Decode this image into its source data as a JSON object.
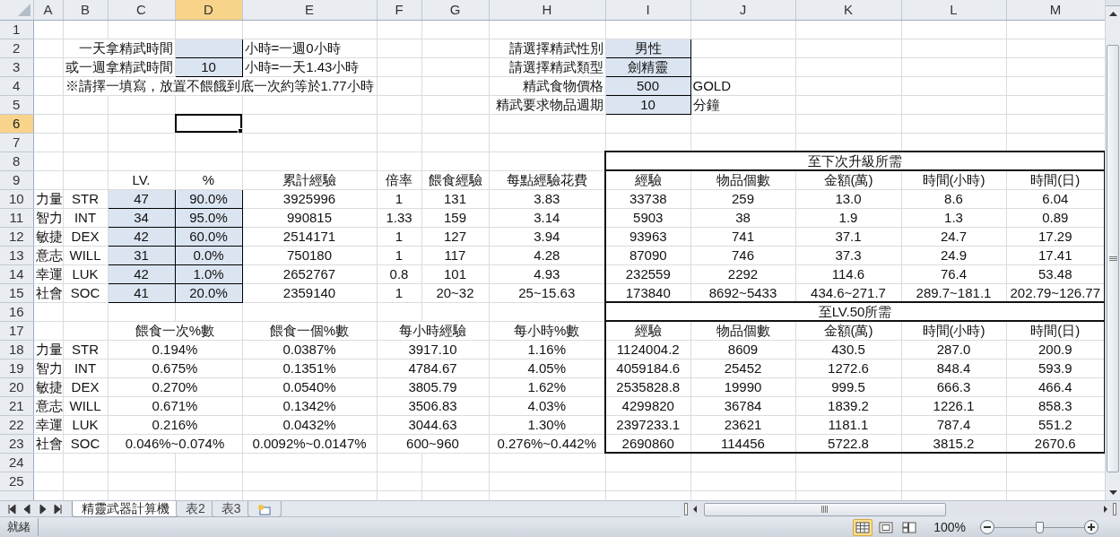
{
  "sheet": {
    "columns": [
      {
        "label": "A",
        "selected": false
      },
      {
        "label": "B",
        "selected": false
      },
      {
        "label": "C",
        "selected": false
      },
      {
        "label": "D",
        "selected": true
      },
      {
        "label": "E",
        "selected": false
      },
      {
        "label": "F",
        "selected": false
      },
      {
        "label": "G",
        "selected": false
      },
      {
        "label": "H",
        "selected": false
      },
      {
        "label": "I",
        "selected": false
      },
      {
        "label": "J",
        "selected": false
      },
      {
        "label": "K",
        "selected": false
      },
      {
        "label": "L",
        "selected": false
      },
      {
        "label": "M",
        "selected": false
      }
    ],
    "rows": [
      {
        "number": "1",
        "selected": false
      },
      {
        "number": "2",
        "selected": false,
        "cells": [
          null,
          null,
          {
            "text": "一天拿精武時間",
            "kind": "label"
          },
          {
            "kind": "input"
          },
          {
            "text": "小時=一週0小時",
            "kind": "note"
          },
          null,
          null,
          {
            "text": "請選擇精武性別",
            "kind": "label"
          },
          {
            "text": "男性",
            "kind": "input"
          }
        ]
      },
      {
        "number": "3",
        "selected": false,
        "cells": [
          null,
          null,
          {
            "text": "或一週拿精武時間",
            "kind": "label"
          },
          {
            "text": "10",
            "kind": "input"
          },
          {
            "text": "小時=一天1.43小時",
            "kind": "note"
          },
          null,
          null,
          {
            "text": "請選擇精武類型",
            "kind": "label"
          },
          {
            "text": "劍精靈",
            "kind": "input"
          }
        ]
      },
      {
        "number": "4",
        "selected": false,
        "cells": [
          null,
          {
            "text": "※請擇一填寫，放置不餵餓到底一次約等於1.77小時",
            "kind": "note"
          },
          null,
          null,
          null,
          null,
          null,
          {
            "text": "精武食物價格",
            "kind": "label"
          },
          {
            "text": "500",
            "kind": "input"
          },
          {
            "text": "GOLD",
            "kind": "note"
          }
        ]
      },
      {
        "number": "5",
        "selected": false,
        "cells": [
          null,
          null,
          null,
          null,
          null,
          null,
          null,
          {
            "text": "精武要求物品週期",
            "kind": "label"
          },
          {
            "text": "10",
            "kind": "input"
          },
          {
            "text": "分鐘",
            "kind": "note"
          }
        ]
      },
      {
        "number": "6",
        "selected": true
      },
      {
        "number": "7",
        "selected": false
      },
      {
        "number": "8",
        "selected": false,
        "cells": [
          null,
          null,
          null,
          null,
          null,
          null,
          null,
          null,
          {
            "text": "至下次升級所需",
            "kind": "title"
          }
        ]
      },
      {
        "number": "9",
        "selected": false,
        "cells": [
          null,
          null,
          "LV.",
          "%",
          "累計經驗",
          "倍率",
          "餵食經驗",
          "每點經驗花費",
          "經驗",
          "物品個數",
          "金額(萬)",
          "時間(小時)",
          "時間(日)"
        ]
      },
      {
        "number": "10",
        "selected": false,
        "cells": [
          "力量",
          "STR",
          {
            "text": "47",
            "kind": "input"
          },
          {
            "text": "90.0%",
            "kind": "input"
          },
          "3925996",
          "1",
          "131",
          "3.83",
          "33738",
          "259",
          "13.0",
          "8.6",
          "6.04"
        ]
      },
      {
        "number": "11",
        "selected": false,
        "cells": [
          "智力",
          "INT",
          {
            "text": "34",
            "kind": "input"
          },
          {
            "text": "95.0%",
            "kind": "input"
          },
          "990815",
          "1.33",
          "159",
          "3.14",
          "5903",
          "38",
          "1.9",
          "1.3",
          "0.89"
        ]
      },
      {
        "number": "12",
        "selected": false,
        "cells": [
          "敏捷",
          "DEX",
          {
            "text": "42",
            "kind": "input"
          },
          {
            "text": "60.0%",
            "kind": "input"
          },
          "2514171",
          "1",
          "127",
          "3.94",
          "93963",
          "741",
          "37.1",
          "24.7",
          "17.29"
        ]
      },
      {
        "number": "13",
        "selected": false,
        "cells": [
          "意志",
          "WILL",
          {
            "text": "31",
            "kind": "input"
          },
          {
            "text": "0.0%",
            "kind": "input"
          },
          "750180",
          "1",
          "117",
          "4.28",
          "87090",
          "746",
          "37.3",
          "24.9",
          "17.41"
        ]
      },
      {
        "number": "14",
        "selected": false,
        "cells": [
          "幸運",
          "LUK",
          {
            "text": "42",
            "kind": "input"
          },
          {
            "text": "1.0%",
            "kind": "input"
          },
          "2652767",
          "0.8",
          "101",
          "4.93",
          "232559",
          "2292",
          "114.6",
          "76.4",
          "53.48"
        ]
      },
      {
        "number": "15",
        "selected": false,
        "cells": [
          "社會",
          "SOC",
          {
            "text": "41",
            "kind": "input"
          },
          {
            "text": "20.0%",
            "kind": "input"
          },
          "2359140",
          "1",
          "20~32",
          "25~15.63",
          "173840",
          "8692~5433",
          "434.6~271.7",
          "289.7~181.1",
          "202.79~126.77"
        ]
      },
      {
        "number": "16",
        "selected": false,
        "cells": [
          null,
          null,
          null,
          null,
          null,
          null,
          null,
          null,
          {
            "text": "至LV.50所需",
            "kind": "title"
          }
        ]
      },
      {
        "number": "17",
        "selected": false,
        "cells": [
          null,
          null,
          {
            "text": "餵食一次%數",
            "kind": "merged"
          },
          null,
          "餵食一個%數",
          {
            "text": "每小時經驗",
            "kind": "merged"
          },
          null,
          "每小時%數",
          "經驗",
          "物品個數",
          "金額(萬)",
          "時間(小時)",
          "時間(日)"
        ]
      },
      {
        "number": "18",
        "selected": false,
        "cells": [
          "力量",
          "STR",
          {
            "text": "0.194%",
            "kind": "merged"
          },
          null,
          "0.0387%",
          {
            "text": "3917.10",
            "kind": "merged"
          },
          null,
          "1.16%",
          "1124004.2",
          "8609",
          "430.5",
          "287.0",
          "200.9"
        ]
      },
      {
        "number": "19",
        "selected": false,
        "cells": [
          "智力",
          "INT",
          {
            "text": "0.675%",
            "kind": "merged"
          },
          null,
          "0.1351%",
          {
            "text": "4784.67",
            "kind": "merged"
          },
          null,
          "4.05%",
          "4059184.6",
          "25452",
          "1272.6",
          "848.4",
          "593.9"
        ]
      },
      {
        "number": "20",
        "selected": false,
        "cells": [
          "敏捷",
          "DEX",
          {
            "text": "0.270%",
            "kind": "merged"
          },
          null,
          "0.0540%",
          {
            "text": "3805.79",
            "kind": "merged"
          },
          null,
          "1.62%",
          "2535828.8",
          "19990",
          "999.5",
          "666.3",
          "466.4"
        ]
      },
      {
        "number": "21",
        "selected": false,
        "cells": [
          "意志",
          "WILL",
          {
            "text": "0.671%",
            "kind": "merged"
          },
          null,
          "0.1342%",
          {
            "text": "3506.83",
            "kind": "merged"
          },
          null,
          "4.03%",
          "4299820",
          "36784",
          "1839.2",
          "1226.1",
          "858.3"
        ]
      },
      {
        "number": "22",
        "selected": false,
        "cells": [
          "幸運",
          "LUK",
          {
            "text": "0.216%",
            "kind": "merged"
          },
          null,
          "0.0432%",
          {
            "text": "3044.63",
            "kind": "merged"
          },
          null,
          "1.30%",
          "2397233.1",
          "23621",
          "1181.1",
          "787.4",
          "551.2"
        ]
      },
      {
        "number": "23",
        "selected": false,
        "cells": [
          "社會",
          "SOC",
          {
            "text": "0.046%~0.074%",
            "kind": "merged"
          },
          null,
          "0.0092%~0.0147%",
          {
            "text": "600~960",
            "kind": "merged"
          },
          null,
          "0.276%~0.442%",
          "2690860",
          "114456",
          "5722.8",
          "3815.2",
          "2670.6"
        ]
      },
      {
        "number": "24",
        "selected": false
      },
      {
        "number": "25",
        "selected": false
      }
    ]
  },
  "sheet_tabs": [
    {
      "label": "精靈武器計算機",
      "selected": true
    },
    {
      "label": "表2",
      "selected": false
    },
    {
      "label": "表3",
      "selected": false
    }
  ],
  "status_bar": {
    "status": "就緒",
    "view_buttons": [
      {
        "kind": "normal",
        "selected": true
      },
      {
        "kind": "page_layout",
        "selected": false
      },
      {
        "kind": "page_break",
        "selected": false
      }
    ],
    "zoom": "100%",
    "zoom_slider": {
      "level": 0.5
    }
  }
}
